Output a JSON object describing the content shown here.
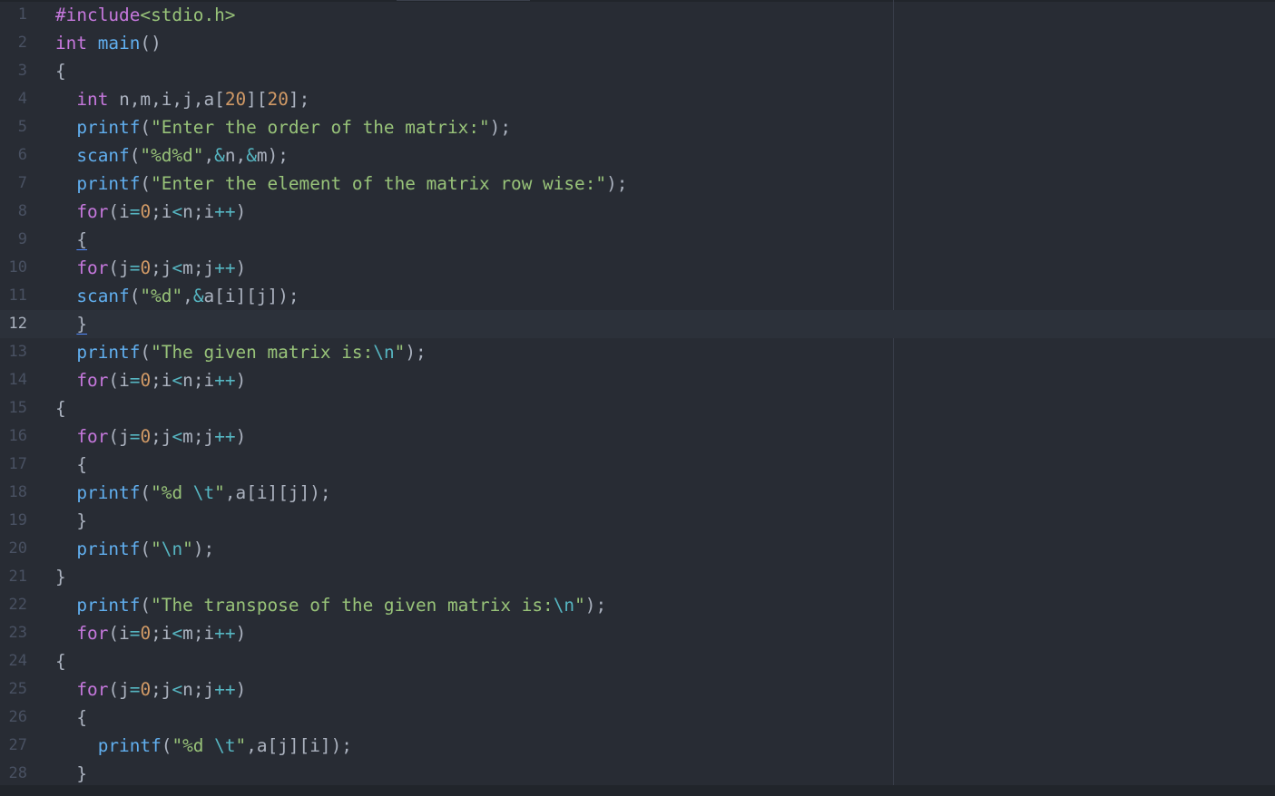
{
  "editor": {
    "language": "c",
    "cursor_line": 12,
    "colors": {
      "background": "#282c34",
      "keyword": "#c678dd",
      "function": "#61afef",
      "string": "#98c379",
      "number": "#d19a66",
      "escape": "#56b6c2",
      "gutter": "#495162"
    },
    "lines": [
      {
        "n": "1",
        "indent": "",
        "tokens": [
          [
            "kw",
            "#include"
          ],
          [
            "str",
            "<stdio.h>"
          ]
        ]
      },
      {
        "n": "2",
        "indent": "",
        "tokens": [
          [
            "kw",
            "int"
          ],
          [
            "pun",
            " "
          ],
          [
            "fn",
            "main"
          ],
          [
            "pun",
            "()"
          ]
        ]
      },
      {
        "n": "3",
        "indent": "",
        "tokens": [
          [
            "pun",
            "{"
          ]
        ]
      },
      {
        "n": "4",
        "indent": "  ",
        "tokens": [
          [
            "kw",
            "int"
          ],
          [
            "pun",
            " n,m,i,j,a["
          ],
          [
            "num",
            "20"
          ],
          [
            "pun",
            "]["
          ],
          [
            "num",
            "20"
          ],
          [
            "pun",
            "];"
          ]
        ]
      },
      {
        "n": "5",
        "indent": "  ",
        "tokens": [
          [
            "fn",
            "printf"
          ],
          [
            "pun",
            "("
          ],
          [
            "str",
            "\"Enter the order of the matrix:\""
          ],
          [
            "pun",
            ");"
          ]
        ]
      },
      {
        "n": "6",
        "indent": "  ",
        "tokens": [
          [
            "fn",
            "scanf"
          ],
          [
            "pun",
            "("
          ],
          [
            "str",
            "\"%d%d\""
          ],
          [
            "pun",
            ","
          ],
          [
            "op",
            "&"
          ],
          [
            "pun",
            "n,"
          ],
          [
            "op",
            "&"
          ],
          [
            "pun",
            "m);"
          ]
        ]
      },
      {
        "n": "7",
        "indent": "  ",
        "tokens": [
          [
            "fn",
            "printf"
          ],
          [
            "pun",
            "("
          ],
          [
            "str",
            "\"Enter the element of the matrix row wise:\""
          ],
          [
            "pun",
            ");"
          ]
        ]
      },
      {
        "n": "8",
        "indent": "  ",
        "tokens": [
          [
            "kw",
            "for"
          ],
          [
            "pun",
            "(i"
          ],
          [
            "op",
            "="
          ],
          [
            "num",
            "0"
          ],
          [
            "pun",
            ";i"
          ],
          [
            "op",
            "<"
          ],
          [
            "pun",
            "n;i"
          ],
          [
            "op",
            "++"
          ],
          [
            "pun",
            ")"
          ]
        ]
      },
      {
        "n": "9",
        "indent": "  ",
        "tokens": [
          [
            "brk",
            "{"
          ]
        ]
      },
      {
        "n": "10",
        "indent": "  ",
        "tokens": [
          [
            "kw",
            "for"
          ],
          [
            "pun",
            "(j"
          ],
          [
            "op",
            "="
          ],
          [
            "num",
            "0"
          ],
          [
            "pun",
            ";j"
          ],
          [
            "op",
            "<"
          ],
          [
            "pun",
            "m;j"
          ],
          [
            "op",
            "++"
          ],
          [
            "pun",
            ")"
          ]
        ]
      },
      {
        "n": "11",
        "indent": "  ",
        "tokens": [
          [
            "fn",
            "scanf"
          ],
          [
            "pun",
            "("
          ],
          [
            "str",
            "\"%d\""
          ],
          [
            "pun",
            ","
          ],
          [
            "op",
            "&"
          ],
          [
            "pun",
            "a[i][j]);"
          ]
        ]
      },
      {
        "n": "12",
        "indent": "  ",
        "tokens": [
          [
            "brk",
            "}"
          ]
        ]
      },
      {
        "n": "13",
        "indent": "  ",
        "tokens": [
          [
            "fn",
            "printf"
          ],
          [
            "pun",
            "("
          ],
          [
            "str",
            "\"The given matrix is:"
          ],
          [
            "esc",
            "\\n"
          ],
          [
            "str",
            "\""
          ],
          [
            "pun",
            ");"
          ]
        ]
      },
      {
        "n": "14",
        "indent": "  ",
        "tokens": [
          [
            "kw",
            "for"
          ],
          [
            "pun",
            "(i"
          ],
          [
            "op",
            "="
          ],
          [
            "num",
            "0"
          ],
          [
            "pun",
            ";i"
          ],
          [
            "op",
            "<"
          ],
          [
            "pun",
            "n;i"
          ],
          [
            "op",
            "++"
          ],
          [
            "pun",
            ")"
          ]
        ]
      },
      {
        "n": "15",
        "indent": "",
        "tokens": [
          [
            "pun",
            "{"
          ]
        ]
      },
      {
        "n": "16",
        "indent": "  ",
        "tokens": [
          [
            "kw",
            "for"
          ],
          [
            "pun",
            "(j"
          ],
          [
            "op",
            "="
          ],
          [
            "num",
            "0"
          ],
          [
            "pun",
            ";j"
          ],
          [
            "op",
            "<"
          ],
          [
            "pun",
            "m;j"
          ],
          [
            "op",
            "++"
          ],
          [
            "pun",
            ")"
          ]
        ]
      },
      {
        "n": "17",
        "indent": "  ",
        "tokens": [
          [
            "pun",
            "{"
          ]
        ]
      },
      {
        "n": "18",
        "indent": "  ",
        "tokens": [
          [
            "fn",
            "printf"
          ],
          [
            "pun",
            "("
          ],
          [
            "str",
            "\"%d "
          ],
          [
            "esc",
            "\\t"
          ],
          [
            "str",
            "\""
          ],
          [
            "pun",
            ",a[i][j]);"
          ]
        ]
      },
      {
        "n": "19",
        "indent": "  ",
        "tokens": [
          [
            "pun",
            "}"
          ]
        ]
      },
      {
        "n": "20",
        "indent": "  ",
        "tokens": [
          [
            "fn",
            "printf"
          ],
          [
            "pun",
            "("
          ],
          [
            "str",
            "\""
          ],
          [
            "esc",
            "\\n"
          ],
          [
            "str",
            "\""
          ],
          [
            "pun",
            ");"
          ]
        ]
      },
      {
        "n": "21",
        "indent": "",
        "tokens": [
          [
            "pun",
            "}"
          ]
        ]
      },
      {
        "n": "22",
        "indent": "  ",
        "tokens": [
          [
            "fn",
            "printf"
          ],
          [
            "pun",
            "("
          ],
          [
            "str",
            "\"The transpose of the given matrix is:"
          ],
          [
            "esc",
            "\\n"
          ],
          [
            "str",
            "\""
          ],
          [
            "pun",
            ");"
          ]
        ]
      },
      {
        "n": "23",
        "indent": "  ",
        "tokens": [
          [
            "kw",
            "for"
          ],
          [
            "pun",
            "(i"
          ],
          [
            "op",
            "="
          ],
          [
            "num",
            "0"
          ],
          [
            "pun",
            ";i"
          ],
          [
            "op",
            "<"
          ],
          [
            "pun",
            "m;i"
          ],
          [
            "op",
            "++"
          ],
          [
            "pun",
            ")"
          ]
        ]
      },
      {
        "n": "24",
        "indent": "",
        "tokens": [
          [
            "pun",
            "{"
          ]
        ]
      },
      {
        "n": "25",
        "indent": "  ",
        "tokens": [
          [
            "kw",
            "for"
          ],
          [
            "pun",
            "(j"
          ],
          [
            "op",
            "="
          ],
          [
            "num",
            "0"
          ],
          [
            "pun",
            ";j"
          ],
          [
            "op",
            "<"
          ],
          [
            "pun",
            "n;j"
          ],
          [
            "op",
            "++"
          ],
          [
            "pun",
            ")"
          ]
        ]
      },
      {
        "n": "26",
        "indent": "  ",
        "tokens": [
          [
            "pun",
            "{"
          ]
        ]
      },
      {
        "n": "27",
        "indent": "    ",
        "tokens": [
          [
            "fn",
            "printf"
          ],
          [
            "pun",
            "("
          ],
          [
            "str",
            "\"%d "
          ],
          [
            "esc",
            "\\t"
          ],
          [
            "str",
            "\""
          ],
          [
            "pun",
            ",a[j][i]);"
          ]
        ]
      },
      {
        "n": "28",
        "indent": "  ",
        "tokens": [
          [
            "pun",
            "}"
          ]
        ]
      }
    ]
  }
}
